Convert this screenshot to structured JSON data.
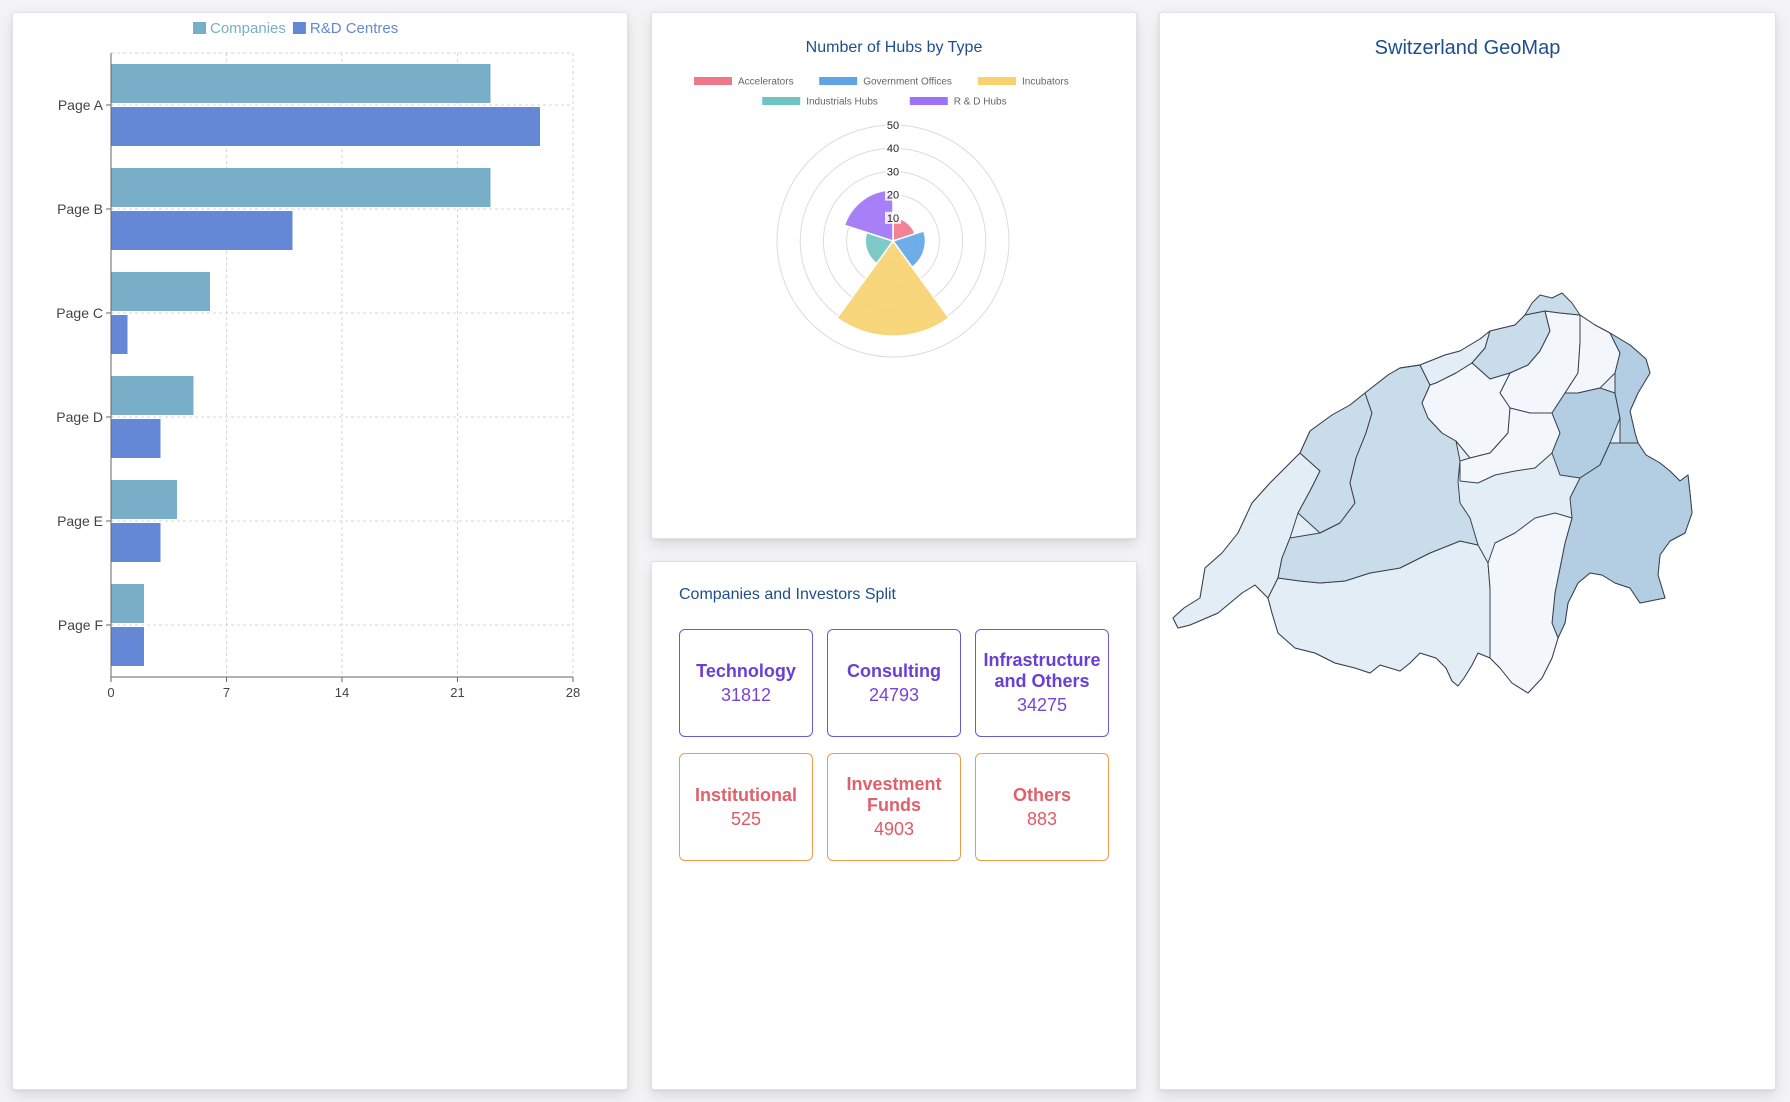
{
  "bar_chart": {
    "legend": [
      {
        "name": "Companies",
        "color": "#79aec8"
      },
      {
        "name": "R&D Centres",
        "color": "#6488d6"
      }
    ],
    "chart_data": {
      "type": "bar",
      "orientation": "horizontal",
      "categories": [
        "Page A",
        "Page B",
        "Page C",
        "Page D",
        "Page E",
        "Page F"
      ],
      "series": [
        {
          "name": "Companies",
          "values": [
            23,
            23,
            6,
            5,
            4,
            2
          ]
        },
        {
          "name": "R&D Centres",
          "values": [
            26,
            11,
            1,
            3,
            3,
            2
          ]
        }
      ],
      "xlim": [
        0,
        28
      ],
      "xticks": [
        "0",
        "7",
        "14",
        "21",
        "28"
      ],
      "grid": true,
      "legend_position": "top"
    }
  },
  "polar_chart": {
    "title": "Number of Hubs by Type",
    "chart_data": {
      "type": "polar-area",
      "categories": [
        "Accelerators",
        "Government Offices",
        "Incubators",
        "Industrials Hubs",
        "R & D Hubs"
      ],
      "values": [
        10,
        14,
        41,
        12,
        22
      ],
      "colors": [
        "#f0768a",
        "#5fa4e6",
        "#f7d26e",
        "#6fc4c2",
        "#9d72f6"
      ],
      "rlim": [
        0,
        50
      ],
      "rticks": [
        "10",
        "20",
        "30",
        "40",
        "50"
      ],
      "legend_position": "top"
    }
  },
  "split": {
    "title": "Companies and Investors Split",
    "companies": [
      {
        "label": "Technology",
        "value": "31812"
      },
      {
        "label": "Consulting",
        "value": "24793"
      },
      {
        "label": "Infrastructure and Others",
        "value": "34275"
      }
    ],
    "investors": [
      {
        "label": "Institutional",
        "value": "525"
      },
      {
        "label": "Investment Funds",
        "value": "4903"
      },
      {
        "label": "Others",
        "value": "883"
      }
    ]
  },
  "map": {
    "title": "Switzerland GeoMap",
    "shade_colors": [
      "#f3f7fb",
      "#e3edf5",
      "#c9dcea",
      "#b3cde2"
    ]
  }
}
